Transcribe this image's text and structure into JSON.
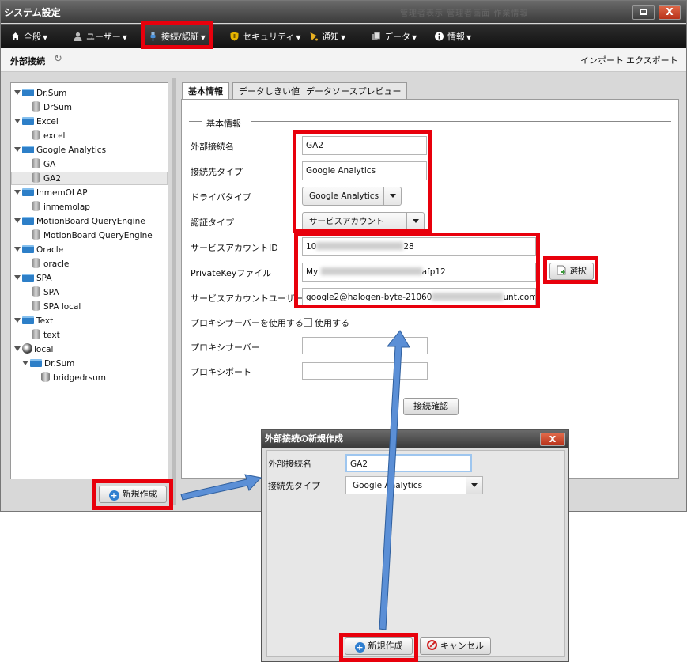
{
  "window": {
    "title": "システム設定",
    "ghost_text": "管理者表示 管理者画面 作業情報",
    "close_label": "X"
  },
  "menu": [
    {
      "icon": "home-icon",
      "label": "全般"
    },
    {
      "icon": "user-icon",
      "label": "ユーザー"
    },
    {
      "icon": "plug-icon",
      "label": "接続/認証"
    },
    {
      "icon": "shield-icon",
      "label": "セキュリティ"
    },
    {
      "icon": "bell-icon",
      "label": "通知"
    },
    {
      "icon": "data-icon",
      "label": "データ"
    },
    {
      "icon": "info-icon",
      "label": "情報"
    }
  ],
  "subbar": {
    "title": "外部接続",
    "import": "インポート",
    "export": "エクスポート"
  },
  "tree": [
    {
      "label": "Dr.Sum",
      "type": "folder"
    },
    {
      "label": "DrSum",
      "type": "db"
    },
    {
      "label": "Excel",
      "type": "folder"
    },
    {
      "label": "excel",
      "type": "db"
    },
    {
      "label": "Google Analytics",
      "type": "folder"
    },
    {
      "label": "GA",
      "type": "db"
    },
    {
      "label": "GA2",
      "type": "db",
      "selected": true
    },
    {
      "label": "InmemOLAP",
      "type": "folder"
    },
    {
      "label": "inmemolap",
      "type": "db"
    },
    {
      "label": "MotionBoard QueryEngine",
      "type": "folder"
    },
    {
      "label": "MotionBoard QueryEngine",
      "type": "db"
    },
    {
      "label": "Oracle",
      "type": "folder"
    },
    {
      "label": "oracle",
      "type": "db"
    },
    {
      "label": "SPA",
      "type": "folder"
    },
    {
      "label": "SPA",
      "type": "db"
    },
    {
      "label": "SPA local",
      "type": "db"
    },
    {
      "label": "Text",
      "type": "folder"
    },
    {
      "label": "text",
      "type": "db"
    },
    {
      "label": "local",
      "type": "globe"
    },
    {
      "label": "Dr.Sum",
      "type": "folder"
    },
    {
      "label": "bridgedrsum",
      "type": "db"
    }
  ],
  "tree_new_button": "新規作成",
  "tabs": [
    "基本情報",
    "データしきい値",
    "データソースプレビュー"
  ],
  "form": {
    "section": "基本情報",
    "name_label": "外部接続名",
    "name_value": "GA2",
    "conn_type_label": "接続先タイプ",
    "conn_type_value": "Google Analytics",
    "driver_label": "ドライバタイプ",
    "driver_value": "Google Analytics",
    "auth_label": "認証タイプ",
    "auth_value": "サービスアカウント",
    "sa_id_label": "サービスアカウントID",
    "sa_id_prefix": "10",
    "sa_id_suffix": "28",
    "key_label": "PrivateKeyファイル",
    "key_prefix": "My",
    "key_suffix": "afp12",
    "select_button": "選択",
    "sa_user_label": "サービスアカウントユーザー",
    "sa_user_prefix": "google2@halogen-byte-21060",
    "sa_user_suffix": "unt.com",
    "proxy_use_label": "プロキシサーバーを使用する",
    "proxy_use_check": "使用する",
    "proxy_server_label": "プロキシサーバー",
    "proxy_port_label": "プロキシポート",
    "test_button": "接続確認"
  },
  "dialog": {
    "title": "外部接続の新規作成",
    "close_label": "X",
    "name_label": "外部接続名",
    "name_value": "GA2",
    "type_label": "接続先タイプ",
    "type_value": "Google Analytics",
    "create_button": "新規作成",
    "cancel_button": "キャンセル"
  },
  "colors": {
    "highlight": "#e8000c",
    "arrow": "#5b8fd6"
  }
}
